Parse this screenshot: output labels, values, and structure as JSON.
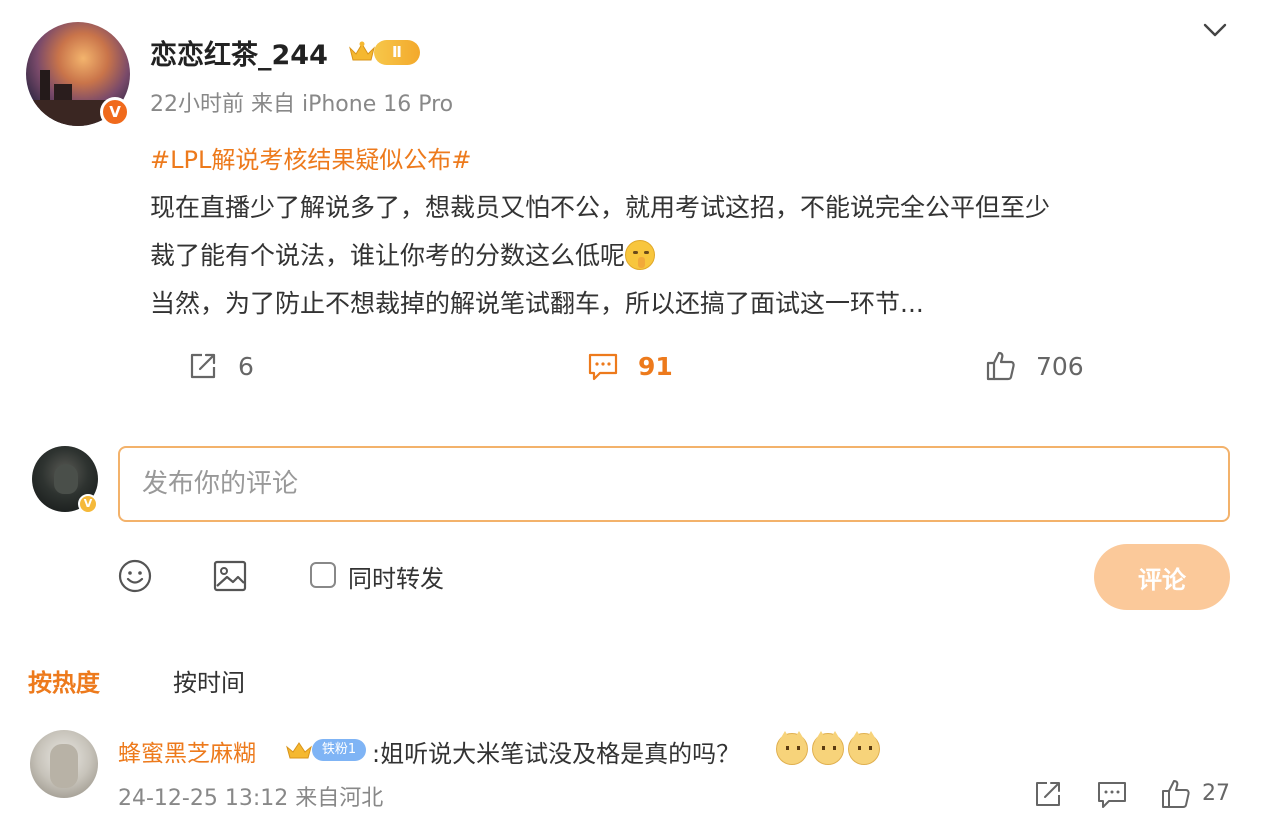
{
  "post": {
    "username": "恋恋红茶_244",
    "level_badge": "Ⅱ",
    "verified_mark": "V",
    "meta": "22小时前 来自 iPhone 16 Pro",
    "hashtag": "#LPL解说考核结果疑似公布#",
    "lines": [
      "现在直播少了解说多了，想裁员又怕不公，就用考试这招，不能说完全公平但至少",
      "裁了能有个说法，谁让你考的分数这么低呢",
      "当然，为了防止不想裁掉的解说笔试翻车，所以还搞了面试这一环节..."
    ],
    "inline_emoji": "shush-emoji",
    "stats": {
      "reposts": "6",
      "comments": "91",
      "likes": "706"
    },
    "colors": {
      "accent": "#ed7a1c",
      "input_border": "#f3b26b",
      "submit_disabled": "#fbc99a"
    }
  },
  "composer": {
    "placeholder": "发布你的评论",
    "repost_label": "同时转发",
    "submit_label": "评论",
    "verified_mark": "V"
  },
  "sort_tabs": {
    "hot": "按热度",
    "time": "按时间"
  },
  "comments": [
    {
      "username": "蜂蜜黑芝麻糊",
      "fan_badge": "铁粉1",
      "text": ":姐听说大米笔试没及格是真的吗？",
      "emojis": [
        "cat-emoji",
        "cat-emoji",
        "cat-emoji"
      ],
      "meta": "24-12-25 13:12 来自河北",
      "likes": "27"
    }
  ]
}
